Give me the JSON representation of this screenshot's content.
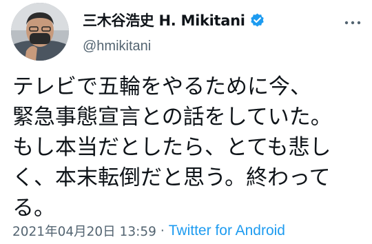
{
  "tweet": {
    "display_name": "三木谷浩史 H. Mikitani",
    "handle": "@hmikitani",
    "verified": true,
    "text_lines": [
      "テレビで五輪をやるために今、",
      "緊急事態宣言との話をしていた。",
      "もし本当だとしたら、とても悲し",
      "く、本末転倒だと思う。終わって",
      "る。"
    ],
    "timestamp": "2021年04月20日 13:59",
    "separator": "·",
    "source": "Twitter for Android"
  },
  "icons": {
    "verified": "verified-badge-icon",
    "more": "more-options-icon",
    "avatar": "profile-photo"
  },
  "colors": {
    "text": "#0f1419",
    "secondary": "#536471",
    "link": "#1d9bf0",
    "verified": "#1d9bf0"
  }
}
